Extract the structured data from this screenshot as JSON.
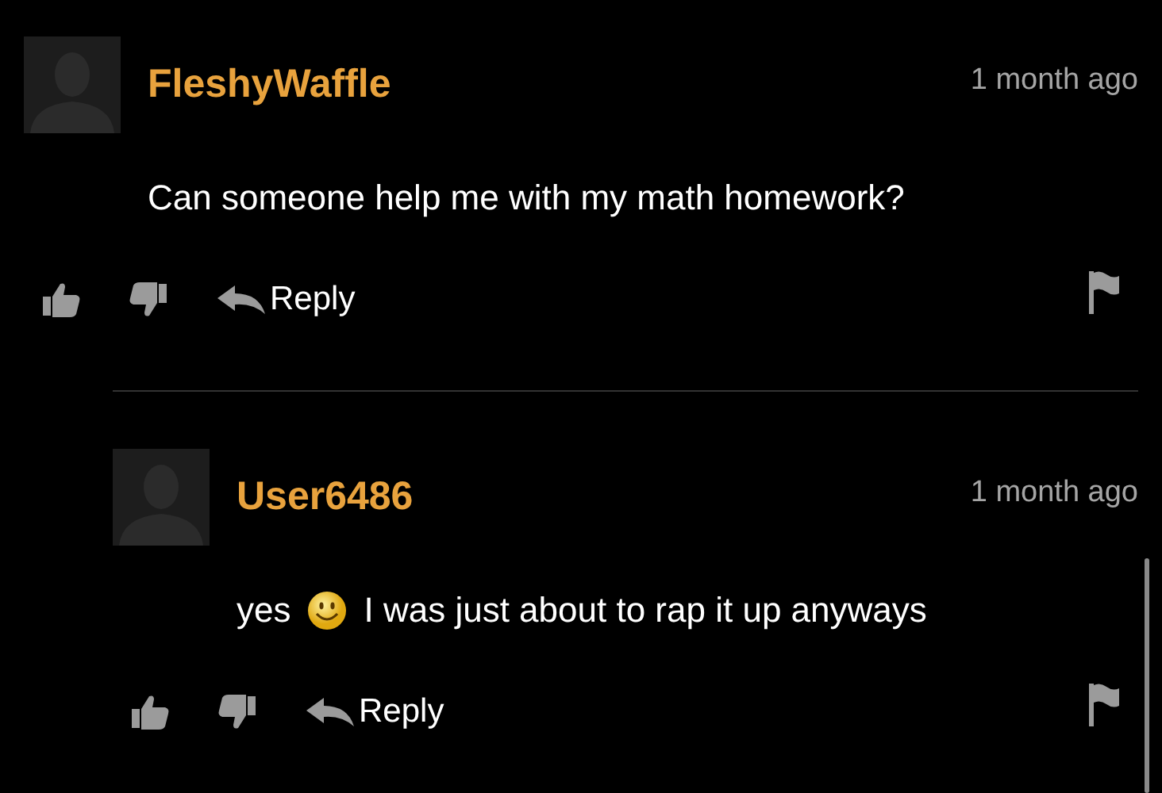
{
  "comments": [
    {
      "author": "FleshyWaffle",
      "time": "1 month ago",
      "parts": [
        {
          "kind": "text",
          "text": "Can someone help me with my math homework?"
        }
      ],
      "reply_label": "Reply",
      "children": [
        {
          "author": "User6486",
          "time": "1 month ago",
          "parts": [
            {
              "kind": "text",
              "text": "yes"
            },
            {
              "kind": "emoji"
            },
            {
              "kind": "text",
              "text": "I was just about to rap it up anyways"
            }
          ],
          "reply_label": "Reply"
        }
      ]
    }
  ]
}
